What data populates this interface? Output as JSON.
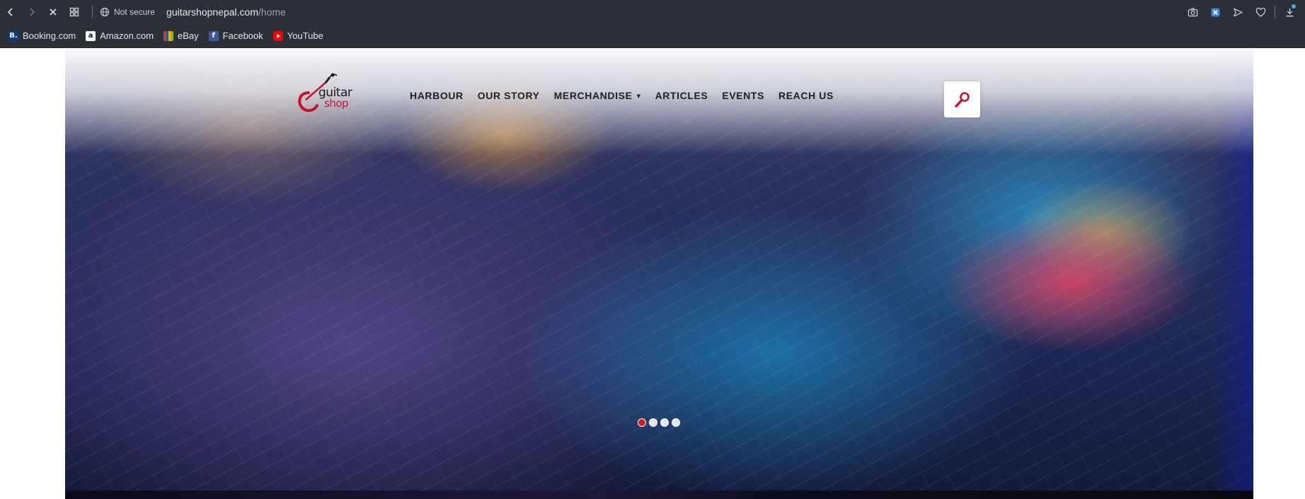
{
  "browser": {
    "nav": {
      "back_icon": "chevron-left-icon",
      "forward_icon": "chevron-right-icon",
      "stop_icon": "close-icon",
      "tabs_icon": "grid-icon"
    },
    "security_label": "Not secure",
    "url_domain": "guitarshopnepal.com",
    "url_path": "/home",
    "right_icons": [
      "camera-icon",
      "shield-icon",
      "send-icon",
      "heart-icon",
      "download-icon"
    ]
  },
  "bookmarks": [
    {
      "label": "Booking.com",
      "icon": "booking-icon",
      "glyph": "B."
    },
    {
      "label": "Amazon.com",
      "icon": "amazon-icon",
      "glyph": "a"
    },
    {
      "label": "eBay",
      "icon": "ebay-icon",
      "glyph": ""
    },
    {
      "label": "Facebook",
      "icon": "facebook-icon",
      "glyph": "f"
    },
    {
      "label": "YouTube",
      "icon": "youtube-icon",
      "glyph": ""
    }
  ],
  "site": {
    "logo": {
      "line1": "guitar",
      "line2": "shop"
    },
    "nav": [
      {
        "label": "HARBOUR"
      },
      {
        "label": "OUR STORY"
      },
      {
        "label": "MERCHANDISE",
        "chevron": "▾"
      },
      {
        "label": "ARTICLES"
      },
      {
        "label": "EVENTS"
      },
      {
        "label": "REACH US"
      }
    ],
    "search_icon": "search-icon",
    "slider": {
      "total": 4,
      "active": 1
    },
    "colors": {
      "accent": "#d11b23",
      "nav_text": "#1f1f1f"
    }
  }
}
